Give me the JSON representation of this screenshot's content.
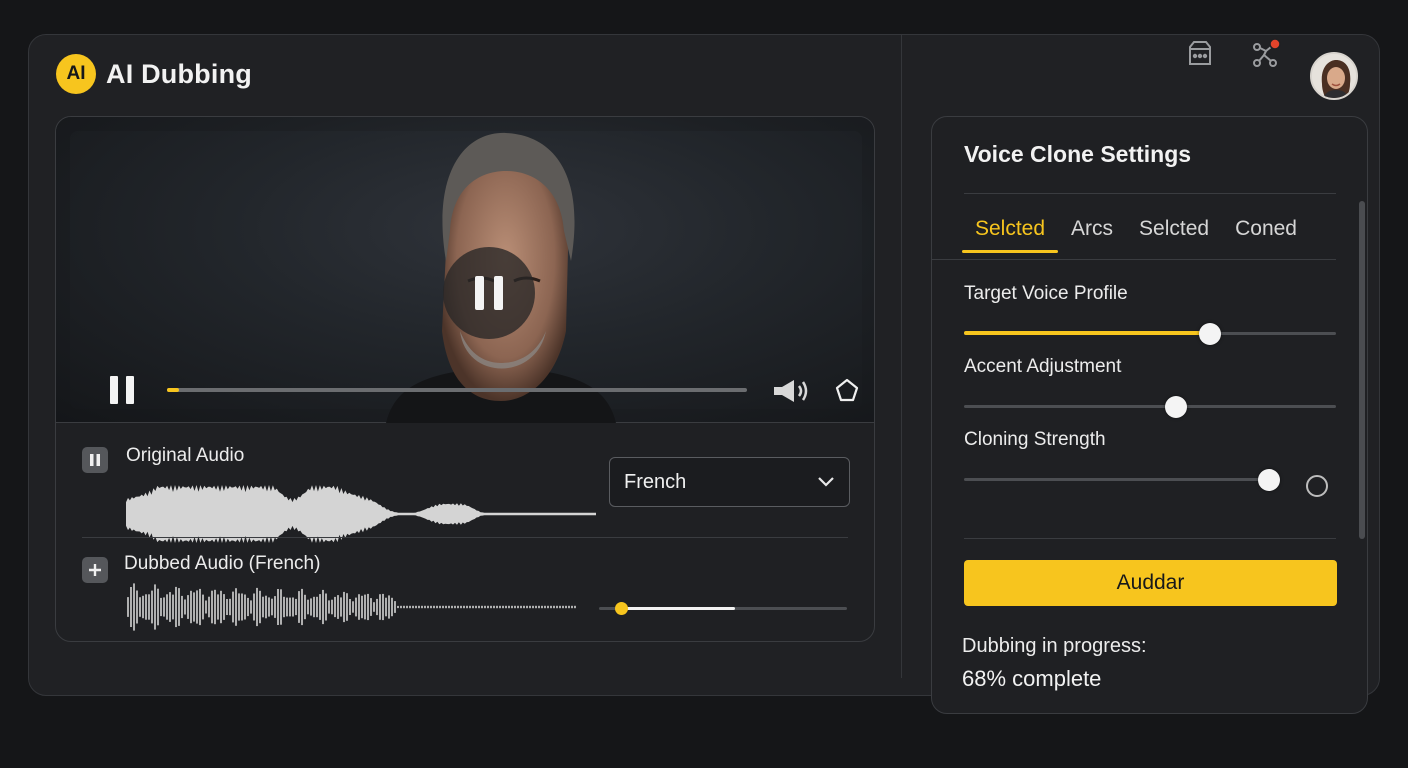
{
  "app": {
    "logo_text": "AI",
    "title": "AI Dubbing"
  },
  "header_icons": [
    "chat-icon",
    "network-icon",
    "avatar"
  ],
  "player": {
    "progress": 0.02,
    "icons": [
      "pause-icon",
      "volume-icon",
      "pip-icon"
    ]
  },
  "tracks": {
    "original": {
      "label": "Original Audio",
      "button_icon": "pause-icon"
    },
    "dubbed": {
      "label": "Dubbed Audio (French)",
      "button_icon": "plus-icon",
      "level": 0.55
    },
    "language_select": {
      "value": "French"
    }
  },
  "settings": {
    "title": "Voice Clone Settings",
    "tabs": [
      {
        "label": "Selcted",
        "active": true
      },
      {
        "label": "Arcs",
        "active": false
      },
      {
        "label": "Selcted",
        "active": false
      },
      {
        "label": "Coned",
        "active": false
      }
    ],
    "sliders": [
      {
        "label": "Target Voice Profile",
        "value": 0.66,
        "filled": true
      },
      {
        "label": "Accent Adjustment",
        "value": 0.57,
        "filled": false
      },
      {
        "label": "Cloning Strength",
        "value": 0.82,
        "filled": false
      }
    ],
    "action_label": "Auddar",
    "status_line1": "Dubbing in progress:",
    "status_line2": "68% complete"
  },
  "colors": {
    "accent": "#f7c51e",
    "background": "#151618",
    "panel": "#1f2023"
  }
}
